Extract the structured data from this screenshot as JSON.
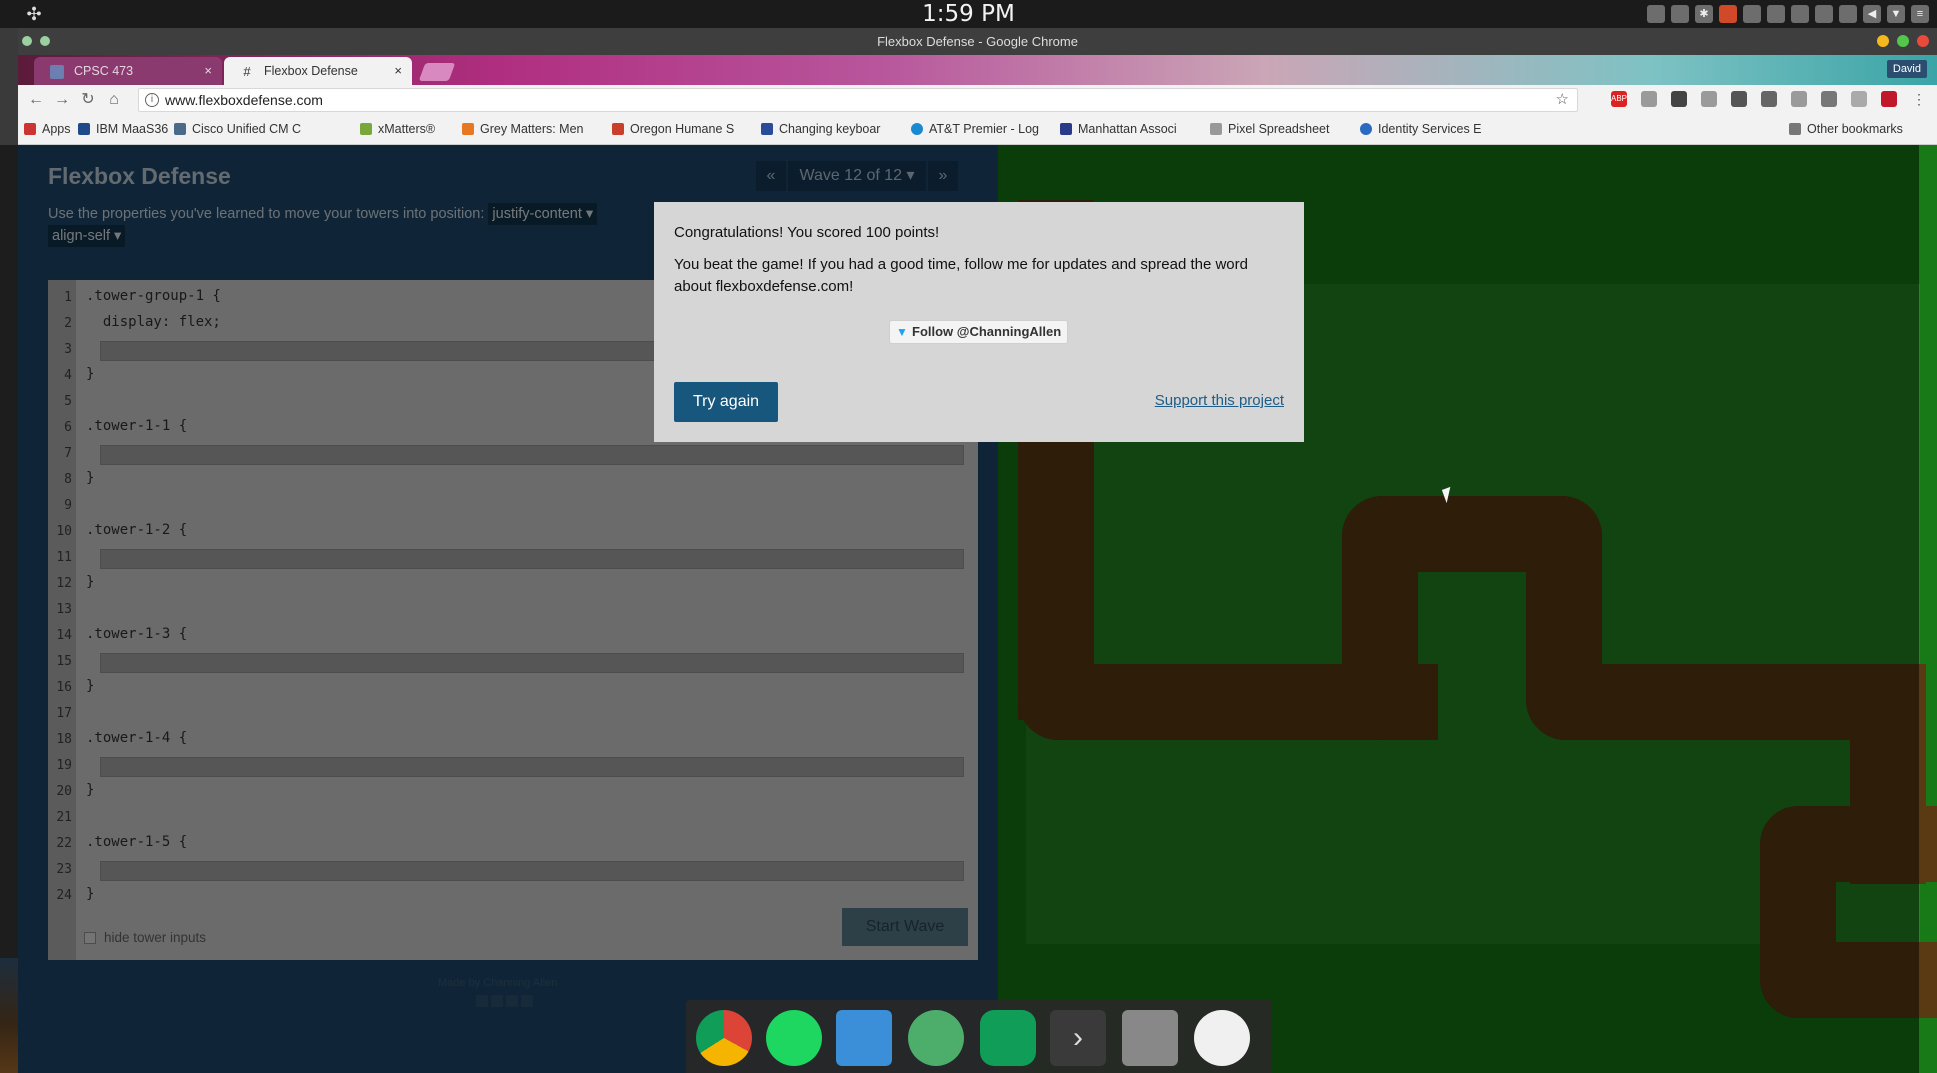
{
  "os": {
    "clock": "1:59 PM"
  },
  "browser": {
    "window_title": "Flexbox Defense - Google Chrome",
    "profile": "David",
    "tabs": [
      {
        "label": "CPSC 473",
        "active": false
      },
      {
        "label": "Flexbox Defense",
        "active": true
      }
    ],
    "url": "www.flexboxdefense.com",
    "bookmarks": [
      "Apps",
      "IBM MaaS360",
      "Cisco Unified CM C",
      "xMatters®",
      "Grey Matters: Men",
      "Oregon Humane S",
      "Changing keyboar",
      "AT&T Premier - Log",
      "Manhattan Associ",
      "Pixel Spreadsheet",
      "Identity Services E"
    ],
    "other_bookmarks": "Other bookmarks"
  },
  "game": {
    "title": "Flexbox Defense",
    "wave_label": "Wave 12 of 12 ▾",
    "prev": "«",
    "next": "»",
    "instructions_prefix": "Use the properties you've learned to move your towers into position:",
    "prop_justify": "justify-content ▾",
    "prop_align_self": "align-self ▾",
    "code_lines": [
      ".tower-group-1 {",
      "  display: flex;",
      "",
      "}",
      "",
      ".tower-1-1 {",
      "",
      "}",
      "",
      ".tower-1-2 {",
      "",
      "}",
      "",
      ".tower-1-3 {",
      "",
      "}",
      "",
      ".tower-1-4 {",
      "",
      "}",
      "",
      ".tower-1-5 {",
      "",
      "}"
    ],
    "line_numbers": [
      "1",
      "2",
      "3",
      "4",
      "5",
      "6",
      "7",
      "8",
      "9",
      "10",
      "11",
      "12",
      "13",
      "14",
      "15",
      "16",
      "17",
      "18",
      "19",
      "20",
      "21",
      "22",
      "23",
      "24"
    ],
    "start_wave": "Start Wave",
    "hide_inputs": "hide tower inputs",
    "credit": "Made by Channing Allen"
  },
  "modal": {
    "score_text": "Congratulations! You scored 100 points!",
    "message": "You beat the game! If you had a good time, follow me for updates and spread the word about flexboxdefense.com!",
    "follow": "Follow @ChanningAllen",
    "try_again": "Try again",
    "support": "Support this project"
  },
  "dock": {
    "apps": [
      "chrome-icon",
      "spotify-icon",
      "files-icon",
      "atom-icon",
      "hangouts-icon",
      "terminal-icon",
      "screenshot-icon",
      "clock-icon"
    ]
  },
  "colors": {
    "accent": "#17577d",
    "grass": "#177a17",
    "path": "#5a3a12"
  }
}
